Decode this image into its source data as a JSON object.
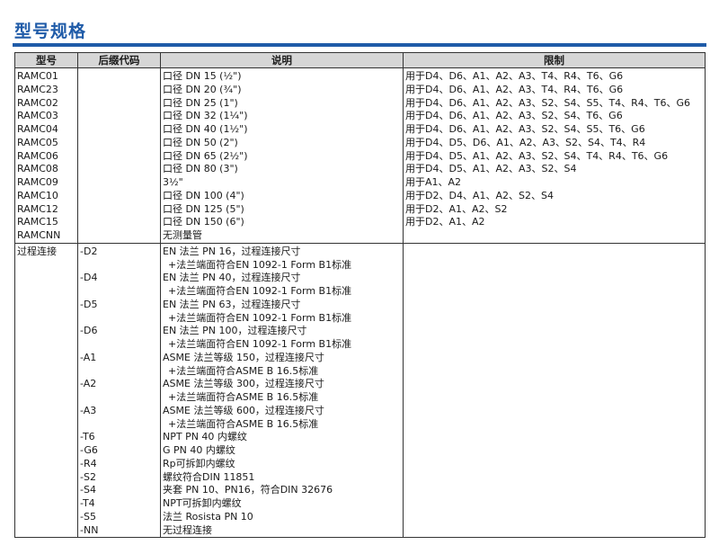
{
  "title": "型号规格",
  "accent_color": "#1f5ba8",
  "table": {
    "headers": [
      "型号",
      "后缀代码",
      "说明",
      "限制"
    ],
    "model_rows": [
      {
        "model": "RAMC01",
        "desc": "口径 DN 15 (½\")",
        "limit": "用于D4、D6、A1、A2、A3、T4、R4、T6、G6"
      },
      {
        "model": "RAMC23",
        "desc": "口径 DN 20 (¾\")",
        "limit": "用于D4、D6、A1、A2、A3、T4、R4、T6、G6"
      },
      {
        "model": "RAMC02",
        "desc": "口径 DN 25 (1\")",
        "limit": "用于D4、D6、A1、A2、A3、S2、S4、S5、T4、R4、T6、G6"
      },
      {
        "model": "RAMC03",
        "desc": "口径 DN 32 (1¼\")",
        "limit": "用于D4、D6、A1、A2、A3、S2、S4、T6、G6"
      },
      {
        "model": "RAMC04",
        "desc": "口径 DN 40 (1½\")",
        "limit": "用于D4、D6、A1、A2、A3、S2、S4、S5、T6、G6"
      },
      {
        "model": "RAMC05",
        "desc": "口径 DN 50 (2\")",
        "limit": "用于D4、D5、D6、A1、A2、A3、S2、S4、T4、R4"
      },
      {
        "model": "RAMC06",
        "desc": "口径 DN 65 (2½\")",
        "limit": "用于D4、D5、A1、A2、A3、S2、S4、T4、R4、T6、G6"
      },
      {
        "model": "RAMC08",
        "desc": "口径 DN 80 (3\")",
        "limit": "用于D4、D5、A1、A2、A3、S2、S4"
      },
      {
        "model": "RAMC09",
        "desc": "3½\"",
        "limit": "用于A1、A2"
      },
      {
        "model": "RAMC10",
        "desc": "口径 DN 100 (4\")",
        "limit": "用于D2、D4、A1、A2、S2、S4"
      },
      {
        "model": "RAMC12",
        "desc": "口径 DN 125 (5\")",
        "limit": "用于D2、A1、A2、S2"
      },
      {
        "model": "RAMC15",
        "desc": "口径 DN 150 (6\")",
        "limit": "用于D2、A1、A2"
      },
      {
        "model": "RAMCNN",
        "desc": "无测量管",
        "limit": ""
      }
    ],
    "process_label": "过程连接",
    "process_rows": [
      {
        "code": "-D2",
        "desc": "EN 法兰 PN 16，过程连接尺寸",
        "desc2": "+法兰端面符合EN 1092-1 Form B1标准"
      },
      {
        "code": "-D4",
        "desc": "EN 法兰 PN 40，过程连接尺寸",
        "desc2": "+法兰端面符合EN 1092-1 Form B1标准"
      },
      {
        "code": "-D5",
        "desc": "EN 法兰 PN 63，过程连接尺寸",
        "desc2": "+法兰端面符合EN 1092-1 Form B1标准"
      },
      {
        "code": "-D6",
        "desc": "EN 法兰 PN 100，过程连接尺寸",
        "desc2": "+法兰端面符合EN 1092-1 Form B1标准"
      },
      {
        "code": "-A1",
        "desc": "ASME 法兰等级 150，过程连接尺寸",
        "desc2": "+法兰端面符合ASME B 16.5标准"
      },
      {
        "code": "-A2",
        "desc": "ASME 法兰等级 300，过程连接尺寸",
        "desc2": "+法兰端面符合ASME B 16.5标准"
      },
      {
        "code": "-A3",
        "desc": "ASME 法兰等级 600，过程连接尺寸",
        "desc2": "+法兰端面符合ASME B 16.5标准"
      },
      {
        "code": "-T6",
        "desc": "NPT PN 40 内螺纹",
        "desc2": ""
      },
      {
        "code": "-G6",
        "desc": "G PN 40 内螺纹",
        "desc2": ""
      },
      {
        "code": "-R4",
        "desc": "Rp可拆卸内螺纹",
        "desc2": ""
      },
      {
        "code": "-S2",
        "desc": "螺纹符合DIN 11851",
        "desc2": ""
      },
      {
        "code": "-S4",
        "desc": "夹套 PN 10、PN16，符合DIN 32676",
        "desc2": ""
      },
      {
        "code": "-T4",
        "desc": "NPT可拆卸内螺纹",
        "desc2": ""
      },
      {
        "code": "-S5",
        "desc": "法兰 Rosista PN 10",
        "desc2": ""
      },
      {
        "code": "-NN",
        "desc": "无过程连接",
        "desc2": ""
      }
    ]
  }
}
